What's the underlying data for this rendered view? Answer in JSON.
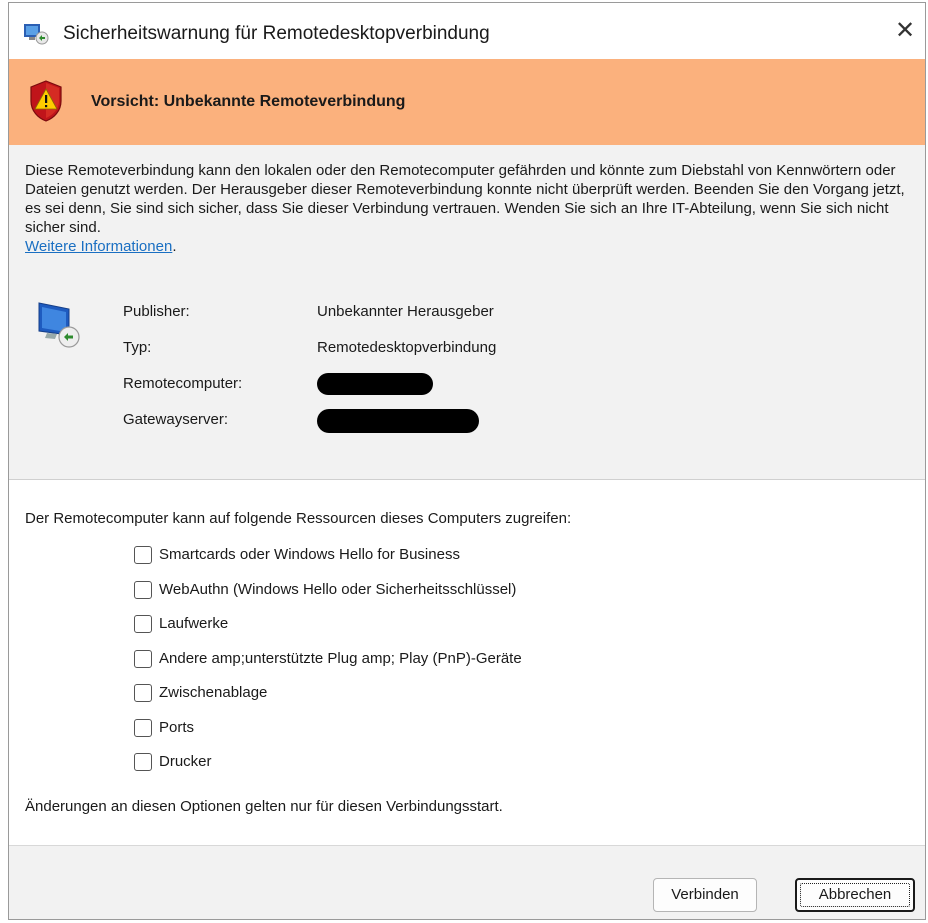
{
  "window": {
    "title": "Sicherheitswarnung für Remotedesktopverbindung",
    "close_glyph": "✕"
  },
  "banner": {
    "text": "Vorsicht: Unbekannte Remoteverbindung",
    "icon": "shield-warning-icon",
    "color": "#fbb17d"
  },
  "description": {
    "text": "Diese Remoteverbindung kann den lokalen oder den Remotecomputer gefährden und könnte zum Diebstahl von Kennwörtern oder Dateien genutzt werden. Der Herausgeber dieser Remoteverbindung konnte nicht überprüft werden. Beenden Sie den Vorgang jetzt, es sei denn, Sie sind sich sicher, dass Sie dieser Verbindung vertrauen. Wenden Sie sich an Ihre IT-Abteilung, wenn Sie sich nicht sicher sind.",
    "link": "Weitere Informationen",
    "link_suffix": "."
  },
  "info": {
    "publisher_label": "Publisher:",
    "publisher_value": "Unbekannter Herausgeber",
    "type_label": "Typ:",
    "type_value": "Remotedesktopverbindung",
    "remote_label": "Remotecomputer:",
    "gateway_label": "Gatewayserver:"
  },
  "resources": {
    "heading": "Der Remotecomputer kann auf folgende Ressourcen dieses Computers zugreifen:",
    "items": [
      {
        "label": "Smartcards oder Windows Hello for Business",
        "checked": false
      },
      {
        "label": "WebAuthn (Windows Hello oder Sicherheitsschlüssel)",
        "checked": false
      },
      {
        "label": "Laufwerke",
        "checked": false
      },
      {
        "label": "Andere amp;unterstützte Plug amp; Play (PnP)-Geräte",
        "checked": false
      },
      {
        "label": "Zwischenablage",
        "checked": false
      },
      {
        "label": "Ports",
        "checked": false
      },
      {
        "label": "Drucker",
        "checked": false
      }
    ],
    "note": "Änderungen an diesen Optionen gelten nur für diesen Verbindungsstart."
  },
  "buttons": {
    "connect": "Verbinden",
    "cancel": "Abbrechen"
  }
}
